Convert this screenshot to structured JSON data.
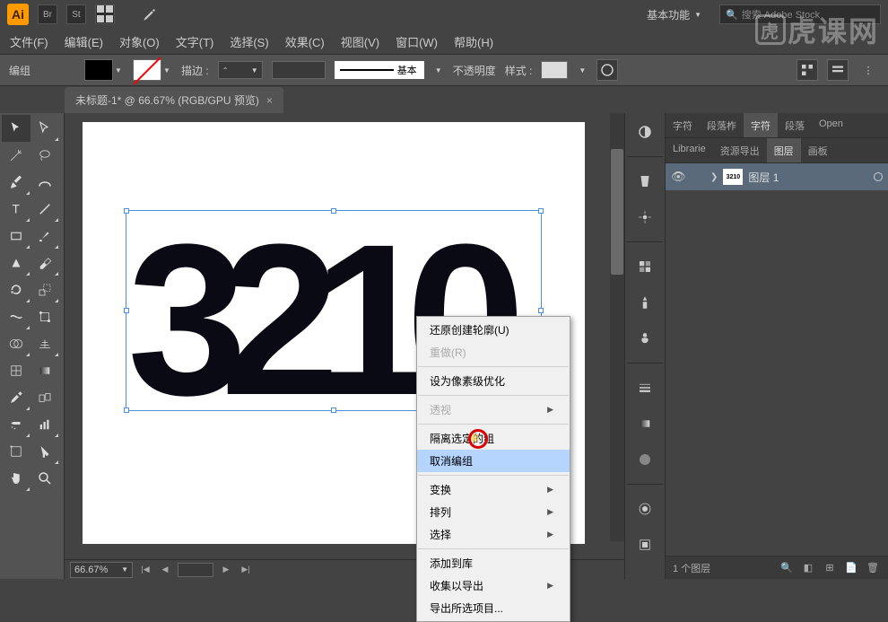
{
  "topbar": {
    "workspace": "基本功能",
    "search_placeholder": "搜索 Adobe Stock"
  },
  "menu": {
    "file": "文件(F)",
    "edit": "编辑(E)",
    "object": "对象(O)",
    "type": "文字(T)",
    "select": "选择(S)",
    "effect": "效果(C)",
    "view": "视图(V)",
    "window": "窗口(W)",
    "help": "帮助(H)"
  },
  "control": {
    "group_label": "编组",
    "stroke_label": "描边 :",
    "stroke_weight": "",
    "line_style": "基本",
    "opacity_label": "不透明度",
    "style_label": "样式 :"
  },
  "doc_tab": {
    "title": "未标题-1* @ 66.67% (RGB/GPU 预览)"
  },
  "canvas": {
    "text": "3210",
    "zoom": "66.67%"
  },
  "context": {
    "undo": "还原创建轮廓(U)",
    "redo": "重做(R)",
    "pixel_optimize": "设为像素级优化",
    "perspective": "透视",
    "isolate": "隔离选定的组",
    "ungroup": "取消编组",
    "transform": "变换",
    "arrange": "排列",
    "select": "选择",
    "add_to_lib": "添加到库",
    "collect_export": "收集以导出",
    "export_selection": "导出所选项目..."
  },
  "right_tabs_1": {
    "char": "字符",
    "para_short": "段落柞",
    "char2": "字符",
    "para": "段落",
    "open": "Open"
  },
  "right_tabs_2": {
    "lib": "Librarie",
    "assets": "资源导出",
    "layers": "图层",
    "artboards": "画板"
  },
  "layers": {
    "layer1_name": "图层 1",
    "thumb_text": "3210",
    "count": "1 个图层"
  },
  "watermark": "虎课网"
}
